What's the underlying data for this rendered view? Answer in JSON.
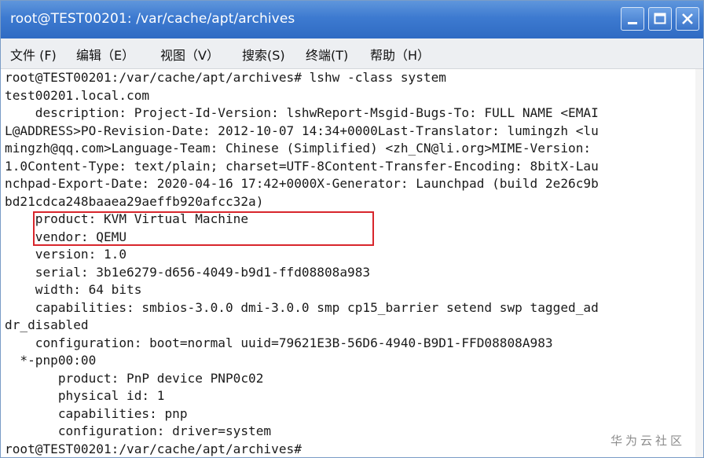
{
  "window": {
    "title": "root@TEST00201: /var/cache/apt/archives"
  },
  "menu": [
    {
      "label": "文件 (F)"
    },
    {
      "label": "编辑（E）"
    },
    {
      "label": "视图（V）"
    },
    {
      "label": "搜索(S)"
    },
    {
      "label": "终端(T)"
    },
    {
      "label": "帮助（H）"
    }
  ],
  "terminal": {
    "lines": [
      "root@TEST00201:/var/cache/apt/archives# lshw -class system",
      "test00201.local.com",
      "    description: Project-Id-Version: lshwReport-Msgid-Bugs-To: FULL NAME <EMAI",
      "L@ADDRESS>PO-Revision-Date: 2012-10-07 14:34+0000Last-Translator: lumingzh <lu",
      "mingzh@qq.com>Language-Team: Chinese (Simplified) <zh_CN@li.org>MIME-Version:",
      "1.0Content-Type: text/plain; charset=UTF-8Content-Transfer-Encoding: 8bitX-Lau",
      "nchpad-Export-Date: 2020-04-16 17:42+0000X-Generator: Launchpad (build 2e26c9b",
      "bd21cdca248baaea29aeffb920afcc32a)",
      "    product: KVM Virtual Machine",
      "    vendor: QEMU",
      "    version: 1.0",
      "    serial: 3b1e6279-d656-4049-b9d1-ffd08808a983",
      "    width: 64 bits",
      "    capabilities: smbios-3.0.0 dmi-3.0.0 smp cp15_barrier setend swp tagged_ad",
      "dr_disabled",
      "    configuration: boot=normal uuid=79621E3B-56D6-4940-B9D1-FFD08808A983",
      "  *-pnp00:00",
      "       product: PnP device PNP0c02",
      "       physical id: 1",
      "       capabilities: pnp",
      "       configuration: driver=system",
      "root@TEST00201:/var/cache/apt/archives#"
    ]
  },
  "watermark": "华为云社区",
  "colors": {
    "titlebar": "#3d7ad0",
    "menubar": "#edeff2",
    "highlight_border": "#d8262c",
    "terminal_text": "#1a1a1a"
  },
  "icons": [
    "minimize-icon",
    "maximize-icon",
    "close-icon"
  ]
}
